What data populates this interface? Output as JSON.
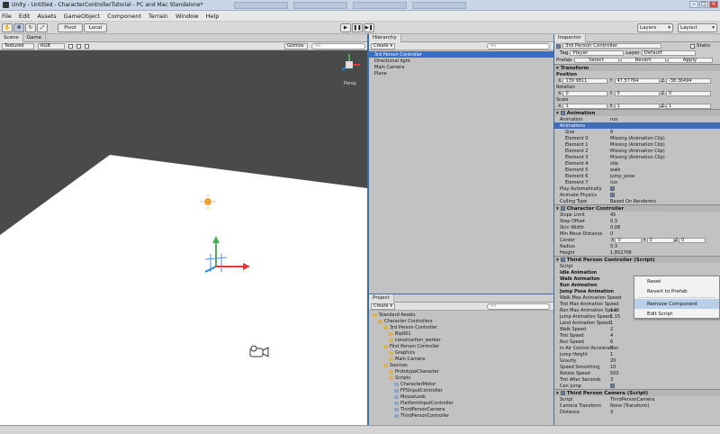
{
  "window": {
    "title": "Unity - Untitled - CharacterControllerTutorial - PC and Mac Standalone*"
  },
  "menu": [
    "File",
    "Edit",
    "Assets",
    "GameObject",
    "Component",
    "Terrain",
    "Window",
    "Help"
  ],
  "toolbar": {
    "pivot": "Pivot",
    "local": "Local",
    "layers": "Layers",
    "layout": "Layout"
  },
  "scene": {
    "tab_scene": "Scene",
    "tab_game": "Game",
    "render_mode": "Textured",
    "color_mode": "RGB",
    "gizmos": "Gizmos",
    "search": "All",
    "persp": "Persp"
  },
  "hierarchy": {
    "tab": "Hierarchy",
    "create": "Create",
    "search": "All",
    "items": [
      "3rd Person Controller",
      "Directional light",
      "Main Camera",
      "Plane"
    ]
  },
  "project": {
    "tab": "Project",
    "create": "Create",
    "search": "All",
    "tree": [
      {
        "label": "Standard Assets",
        "depth": 0
      },
      {
        "label": "Character Controllers",
        "depth": 1
      },
      {
        "label": "3rd Person Controller",
        "depth": 2
      },
      {
        "label": "Bip001",
        "depth": 3
      },
      {
        "label": "construction_worker",
        "depth": 3
      },
      {
        "label": "First Person Controller",
        "depth": 2
      },
      {
        "label": "Graphics",
        "depth": 3
      },
      {
        "label": "Main Camera",
        "depth": 3
      },
      {
        "label": "Sources",
        "depth": 2
      },
      {
        "label": "PrototypeCharacter",
        "depth": 3
      },
      {
        "label": "Scripts",
        "depth": 3
      },
      {
        "label": "CharacterMotor",
        "depth": 4
      },
      {
        "label": "FPSInputController",
        "depth": 4
      },
      {
        "label": "MouseLook",
        "depth": 4
      },
      {
        "label": "PlatformInputController",
        "depth": 4
      },
      {
        "label": "ThirdPersonCamera",
        "depth": 4
      },
      {
        "label": "ThirdPersonController",
        "depth": 4
      }
    ]
  },
  "inspector": {
    "tab": "Inspector",
    "object_name": "3rd Person Controller",
    "static_label": "Static",
    "tag_label": "Tag",
    "tag": "Player",
    "layer_label": "Layer",
    "layer": "Default",
    "prefab": "Prefab",
    "select": "Select",
    "revert": "Revert",
    "apply": "Apply",
    "transform": {
      "title": "Transform",
      "position": "Position",
      "pos": [
        "139.9811",
        "47.57764",
        "-38.36494"
      ],
      "rotation": "Rotation",
      "rot": [
        "0",
        "0",
        "0"
      ],
      "scale": "Scale",
      "scl": [
        "1",
        "1",
        "1"
      ]
    },
    "animation": {
      "title": "Animation",
      "rows": [
        [
          "Animation",
          "run"
        ],
        [
          "Animations",
          ""
        ],
        [
          "Size",
          "8"
        ],
        [
          "Element 0",
          "Missing (Animation Clip)"
        ],
        [
          "Element 1",
          "Missing (Animation Clip)"
        ],
        [
          "Element 2",
          "Missing (Animation Clip)"
        ],
        [
          "Element 3",
          "Missing (Animation Clip)"
        ],
        [
          "Element 4",
          "idle"
        ],
        [
          "Element 5",
          "walk"
        ],
        [
          "Element 6",
          "jump_pose"
        ],
        [
          "Element 7",
          "run"
        ],
        [
          "Play Automatically",
          ""
        ],
        [
          "Animate Physics",
          ""
        ],
        [
          "Culling Type",
          "Based On Renderers"
        ]
      ]
    },
    "cc": {
      "title": "Character Controller",
      "rows": [
        [
          "Slope Limit",
          "45"
        ],
        [
          "Step Offset",
          "0.3"
        ],
        [
          "Skin Width",
          "0.08"
        ],
        [
          "Min Move Distance",
          "0"
        ],
        [
          "Center",
          ""
        ],
        [
          "Radius",
          "0.3"
        ],
        [
          "Height",
          "1.852706"
        ]
      ],
      "center": [
        "0",
        "0",
        "0"
      ]
    },
    "tpc": {
      "title": "Third Person Controller (Script)",
      "rows": [
        [
          "Script",
          ""
        ],
        [
          "Idle Animation",
          ""
        ],
        [
          "Walk Animation",
          ""
        ],
        [
          "Run Animation",
          ""
        ],
        [
          "Jump Pose Animation",
          ""
        ],
        [
          "Walk Max Animation Speed",
          ""
        ],
        [
          "Trot Max Animation Speed",
          ""
        ],
        [
          "Run Max Animation Speed",
          "1.0"
        ],
        [
          "Jump Animation Speed",
          "1.15"
        ],
        [
          "Land Animation Speed",
          "1"
        ],
        [
          "Walk Speed",
          "2"
        ],
        [
          "Trot Speed",
          "4"
        ],
        [
          "Run Speed",
          "6"
        ],
        [
          "In Air Control Acceleration",
          "3"
        ],
        [
          "Jump Height",
          "1"
        ],
        [
          "Gravity",
          "20"
        ],
        [
          "Speed Smoothing",
          "10"
        ],
        [
          "Rotate Speed",
          "500"
        ],
        [
          "Trot After Seconds",
          "3"
        ],
        [
          "Can Jump",
          ""
        ]
      ]
    },
    "tpcam": {
      "title": "Third Person Camera (Script)",
      "rows": [
        [
          "Script",
          "ThirdPersonCamera"
        ],
        [
          "Camera Transform",
          "None (Transform)"
        ],
        [
          "Distance",
          "3"
        ]
      ]
    }
  },
  "context_menu": [
    "Reset",
    "Revert to Prefab",
    "Remove Component",
    "Edit Script"
  ]
}
